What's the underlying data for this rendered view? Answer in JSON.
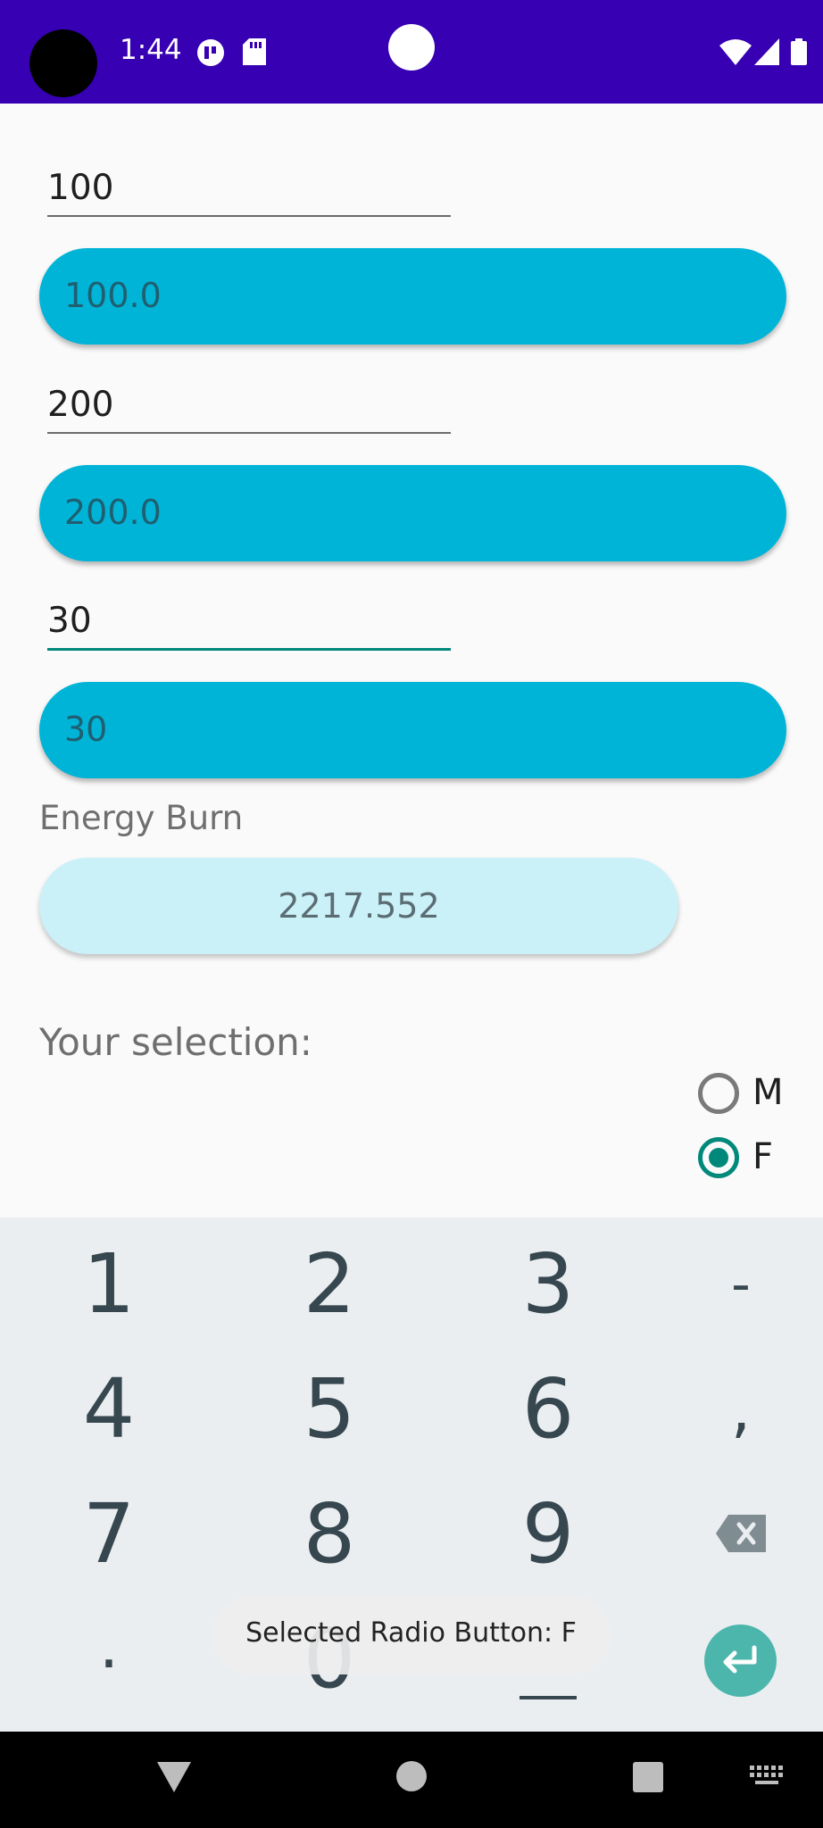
{
  "status_bar": {
    "time": "1:44",
    "icons": [
      "camera-cutout-icon",
      "app-notification-icon",
      "sd-card-icon",
      "wifi-icon",
      "cell-signal-icon",
      "battery-icon"
    ]
  },
  "form": {
    "field1": {
      "value": "100",
      "result": "100.0"
    },
    "field2": {
      "value": "200",
      "result": "200.0"
    },
    "field3": {
      "value": "30",
      "result": "30"
    },
    "energy_label": "Energy Burn",
    "energy_value": "2217.552",
    "selection_label": "Your selection:",
    "radio": {
      "options": [
        "M",
        "F"
      ],
      "selected": "F"
    }
  },
  "keyboard": {
    "keys": [
      "1",
      "2",
      "3",
      "-",
      "4",
      "5",
      "6",
      ",",
      "7",
      "8",
      "9",
      "backspace",
      ".",
      "0",
      "space",
      "enter"
    ]
  },
  "toast": {
    "text": "Selected Radio Button: F"
  },
  "colors": {
    "status_bar": "#3700b3",
    "pill": "#00b4d8",
    "result_pill": "#caf0f8",
    "accent": "#00897b",
    "enter_key": "#4db6ac"
  }
}
